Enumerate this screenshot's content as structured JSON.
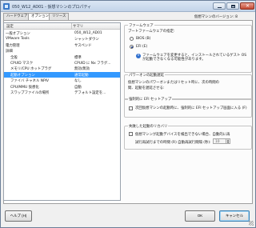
{
  "window": {
    "title": "050_W12_AD01 - 仮想マシンのプロパティ",
    "vm_version_label": "仮想マシンのバージョン: 8"
  },
  "tabs": [
    {
      "label": "ハードウェア",
      "active": false
    },
    {
      "label": "オプション",
      "active": true
    },
    {
      "label": "リソース",
      "active": false
    }
  ],
  "settings_list": {
    "headers": [
      "設定",
      "サマリ"
    ],
    "rows": [
      {
        "name": "一般オプション",
        "summary": "050_W12_AD01",
        "group": true
      },
      {
        "name": "VMware Tools",
        "summary": "シャットダウン",
        "group": true
      },
      {
        "name": "電力管理",
        "summary": "サスペンド",
        "group": true
      },
      {
        "name": "詳細",
        "summary": "",
        "group": true
      },
      {
        "name": "全般",
        "summary": "標準",
        "group": false
      },
      {
        "name": "CPUID マスク",
        "summary": "CPUID に Nx フラグ...",
        "group": false
      },
      {
        "name": "メモリ/CPU ホットプラグ",
        "summary": "無効/無効",
        "group": false
      },
      {
        "name": "起動オプション",
        "summary": "通常起動",
        "group": false,
        "selected": true
      },
      {
        "name": "ファイバ チャネル NPIV",
        "summary": "なし",
        "group": false
      },
      {
        "name": "CPU/MMU 仮想化",
        "summary": "自動",
        "group": false
      },
      {
        "name": "スワップファイルの場所",
        "summary": "デフォルト設定を...",
        "group": false
      }
    ]
  },
  "firmware": {
    "title": "ファームウェア",
    "prompt": "ブートファームウェアの指定:",
    "options": [
      {
        "label": "BIOS (B)",
        "selected": false
      },
      {
        "label": "EFI (E)",
        "selected": true
      }
    ],
    "warning": "ファームウェアを変更すると、インストールされているゲスト OS が起動できなくなる可能性があります。"
  },
  "power_on_delay": {
    "title": "パワーオンの起動遅延",
    "text1": "仮想マシンのパワーオンまたはリセット時に、次の時間の",
    "text2": "間、起動を遅延させる:"
  },
  "force_efi": {
    "title": "強制的に EFI セットアップ",
    "label": "次回仮想マシンの起動時に、強制的に EFI セットアップ画面に入る (F)",
    "checked": false
  },
  "failed_boot": {
    "title": "失敗した起動のリカバリ",
    "checkbox_label": "仮想マシンが起動デバイスを検出できない場合、自動的に再",
    "retry_label": "試行再試行までの時間 (R) 自動再試行間隔 (秒):",
    "retry_value": "10",
    "checked": false
  },
  "buttons": {
    "help": "ヘルプ (H)",
    "ok": "OK",
    "cancel": "キャンセル"
  }
}
